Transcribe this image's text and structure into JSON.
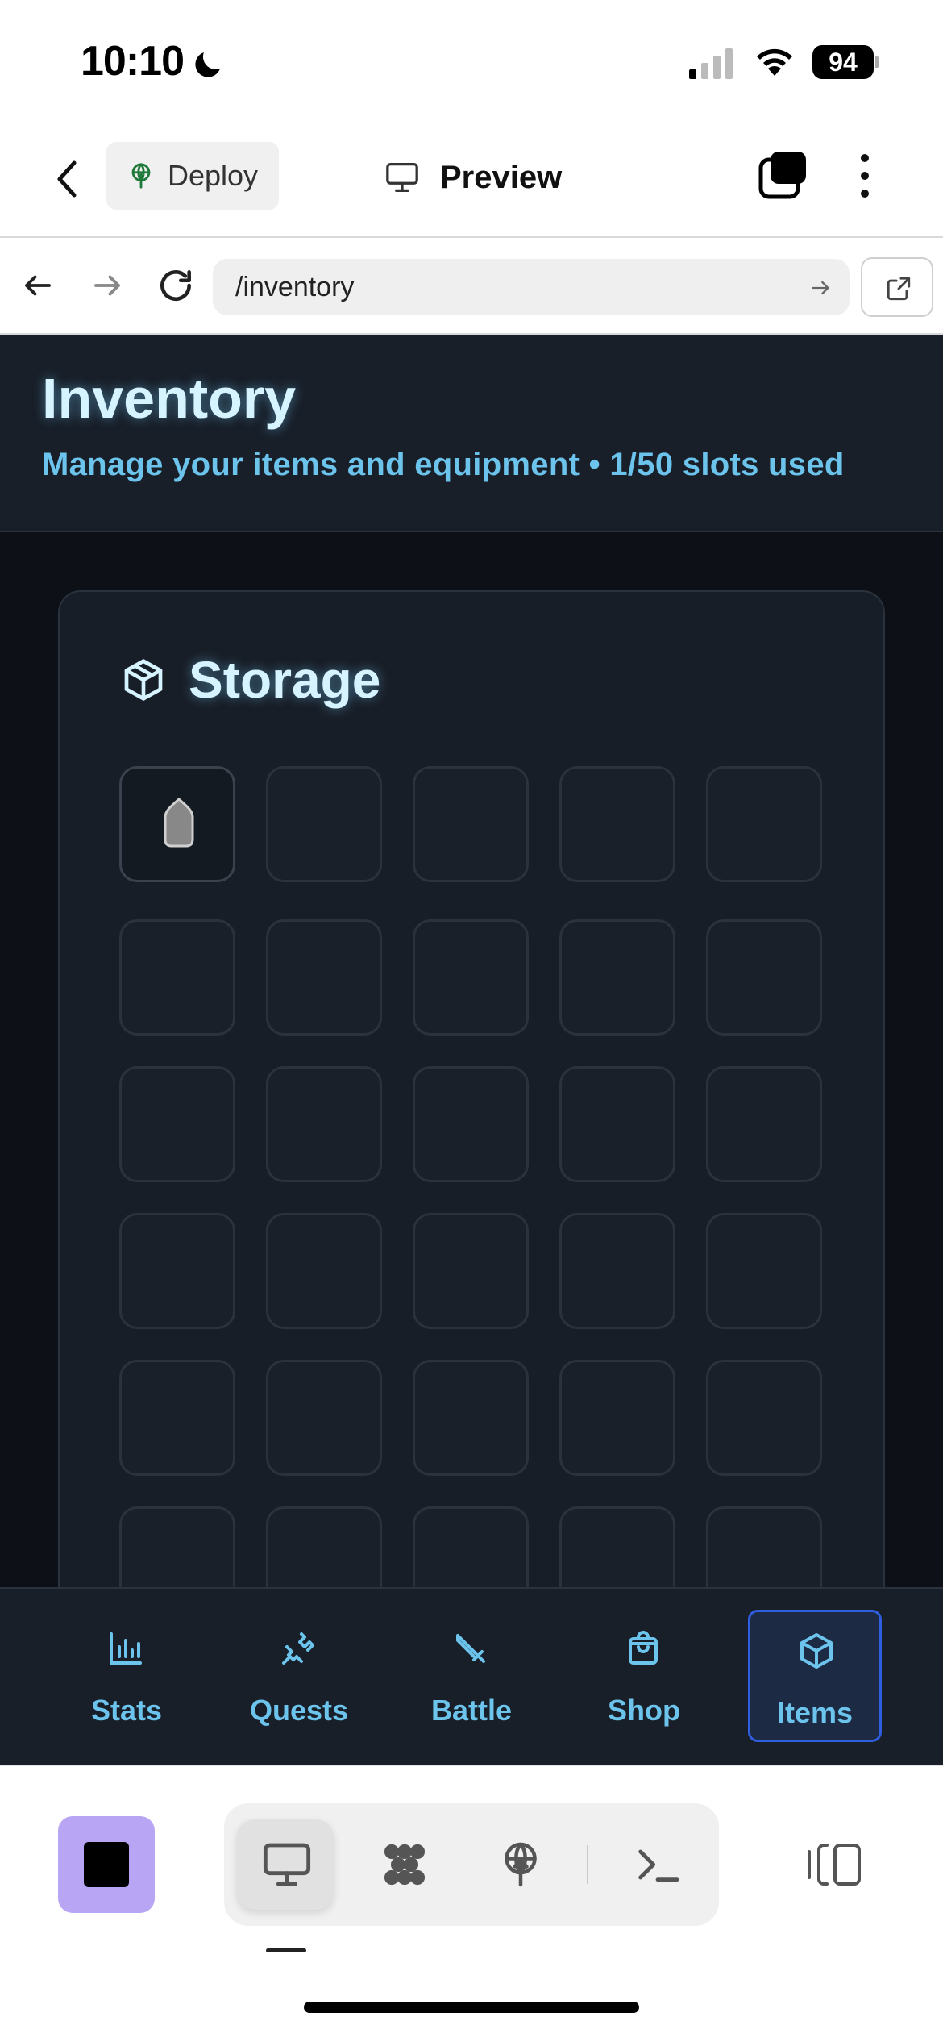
{
  "status_bar": {
    "time": "10:10",
    "battery": "94"
  },
  "app_bar": {
    "deploy_label": "Deploy",
    "title": "Preview"
  },
  "browser": {
    "url": "/inventory"
  },
  "page": {
    "title": "Inventory",
    "subtitle": "Manage your items and equipment • 1/50 slots used"
  },
  "storage": {
    "title": "Storage",
    "slots_used": 1,
    "slots_total": 50,
    "items": [
      {
        "slot": 1,
        "icon": "potion-icon"
      }
    ]
  },
  "nav": {
    "items": [
      {
        "label": "Stats",
        "icon": "bar-chart-icon"
      },
      {
        "label": "Quests",
        "icon": "map-icon"
      },
      {
        "label": "Battle",
        "icon": "sword-icon"
      },
      {
        "label": "Shop",
        "icon": "shopping-bag-icon"
      },
      {
        "label": "Items",
        "icon": "package-icon",
        "active": true
      }
    ]
  },
  "native_bar": {
    "segments": [
      "monitor-icon",
      "grid-icon",
      "deploy-icon",
      "terminal-icon"
    ],
    "active_segment": "monitor-icon"
  },
  "colors": {
    "accent_text": "#6cc4ec",
    "title_text": "#d6f4ff",
    "active_border": "#2f5fe0",
    "stop_button": "#b8a6f5"
  }
}
